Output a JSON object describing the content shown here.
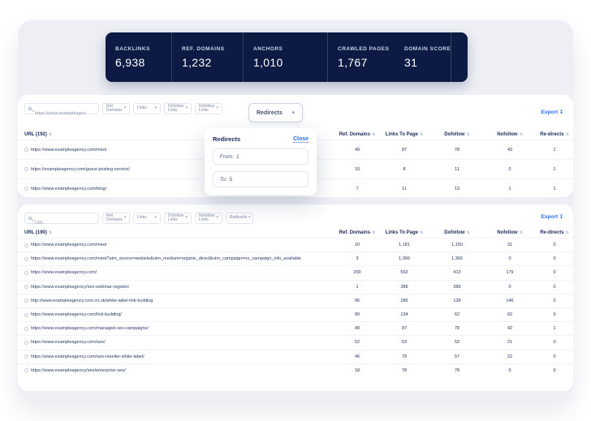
{
  "colors": {
    "navy": "#0d1b44",
    "accent_blue": "#2e6cf4",
    "card_gray": "#edeff5"
  },
  "icons": {
    "sort": "⇅",
    "chevron_down": "▾",
    "export_arrow": "↧"
  },
  "stats": {
    "items": [
      {
        "label": "BACKLINKS",
        "value": "6,938"
      },
      {
        "label": "REF. DOMAINS",
        "value": "1,232"
      },
      {
        "label": "ANCHORS",
        "value": "1,010"
      },
      {
        "label": "CRAWLED PAGES",
        "value": "1,767"
      },
      {
        "label": "DOMAIN SCORE",
        "value": "31"
      }
    ]
  },
  "columns": [
    "Ref. Domains",
    "Links To Page",
    "Dofollow",
    "Nofollow",
    "Re-directs"
  ],
  "table1": {
    "search_value": "https://www.exampleagen",
    "dropdowns": [
      "Ref. Domains",
      "Links",
      "Dofollow Links",
      "Nofollow Links"
    ],
    "redirects_button": "Redirects",
    "export_label": "Export",
    "url_header": "URL (192)",
    "rows": [
      {
        "url": "https://www.exampleagency.com/meet",
        "values": [
          "49",
          "87",
          "78",
          "43",
          "1"
        ]
      },
      {
        "url": "https://exampleagency.com/guest-posting-service/",
        "values": [
          "10",
          "8",
          "11",
          "0",
          "1"
        ]
      },
      {
        "url": "https://www.exampleagency.com/blog/",
        "values": [
          "7",
          "11",
          "13",
          "1",
          "1"
        ]
      }
    ]
  },
  "popup": {
    "title": "Redirects",
    "close_label": "Close",
    "from_label": "From:",
    "from_value": "1",
    "to_label": "To:",
    "to_value": "5"
  },
  "table2": {
    "search_placeholder": "URL",
    "dropdowns": [
      "Ref. Domains",
      "Links",
      "Dofollow Links",
      "Nofollow Links",
      "Redirects"
    ],
    "export_label": "Export",
    "url_header": "URL (190)",
    "rows": [
      {
        "url": "https://www.exampleagency.com/meet",
        "values": [
          "10",
          "1,181",
          "1,150",
          "31",
          "0"
        ]
      },
      {
        "url": "https://www.exampleagency.com/meet?utm_source=website&utm_medium=organic_direct&utm_campaign=no_campaign_info_available",
        "values": [
          "3",
          "1,366",
          "1,366",
          "0",
          "0"
        ]
      },
      {
        "url": "https://www.exampleagency.com/",
        "values": [
          "200",
          "592",
          "413",
          "179",
          "0"
        ]
      },
      {
        "url": "https://www.exampleagency/seo-webinar-register/",
        "values": [
          "1",
          "389",
          "389",
          "0",
          "0"
        ]
      },
      {
        "url": "http://www.exampleagency.com.co.uk/white-label-link-building",
        "values": [
          "96",
          "285",
          "139",
          "146",
          "0"
        ]
      },
      {
        "url": "https://www.exampleagency.com/link-building/",
        "values": [
          "90",
          "134",
          "62",
          "62",
          "0"
        ]
      },
      {
        "url": "https://www.exampleagency.com/managed-seo-campaigns/",
        "values": [
          "49",
          "87",
          "78",
          "42",
          "1"
        ]
      },
      {
        "url": "https://www.exampleagency.com/seo/",
        "values": [
          "52",
          "53",
          "52",
          "21",
          "0"
        ]
      },
      {
        "url": "https://www.exampleagency.com/seo-reseller-white-label/",
        "values": [
          "46",
          "79",
          "57",
          "22",
          "0"
        ]
      },
      {
        "url": "https://www.exampleagency/seo/enterprise-seo/",
        "values": [
          "18",
          "78",
          "78",
          "0",
          "0"
        ]
      }
    ]
  }
}
